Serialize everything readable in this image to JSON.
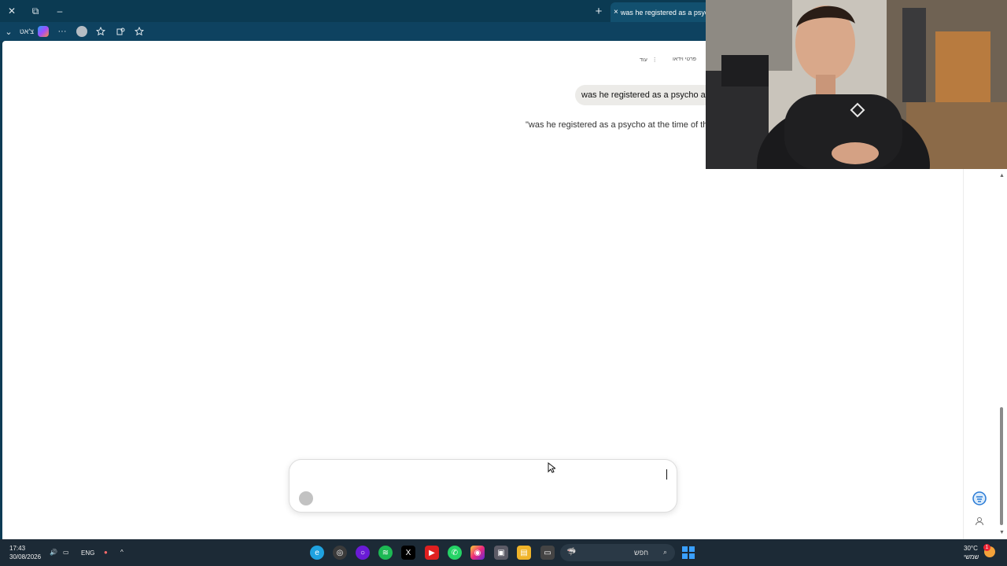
{
  "window": {
    "tab_title": "was he registered as a psycho",
    "tab_close_glyph": "×",
    "new_tab_glyph": "+",
    "restore_glyph": "⧉",
    "minimize_glyph": "–",
    "close_glyph": "✕"
  },
  "toolbar": {
    "chat_label": "צ'אט",
    "more_glyph": "···",
    "dropdown_glyph": "⌄"
  },
  "page": {
    "nav_more": "עוד",
    "nav_more_glyph": "⋮",
    "nav_video": "פרטי וידאו",
    "user_message": "was he registered as a psycho at",
    "reply_text": "\"was he registered as a psycho at the time of the"
  },
  "composer": {
    "placeholder": ""
  },
  "taskbar": {
    "time": "17:43",
    "date": "30/08/2026",
    "lang": "ENG",
    "search_label": "חפש",
    "weather_temp": "30°C",
    "weather_desc": "שמשי",
    "notification_count": "1"
  },
  "colors": {
    "titlebar": "#0b3a52",
    "toolbar": "#0e4260",
    "taskbar": "#1c2a36",
    "edge_accent": "#1fa2e0",
    "spotify": "#1db954",
    "youtube": "#e02020",
    "whatsapp": "#25d366"
  }
}
